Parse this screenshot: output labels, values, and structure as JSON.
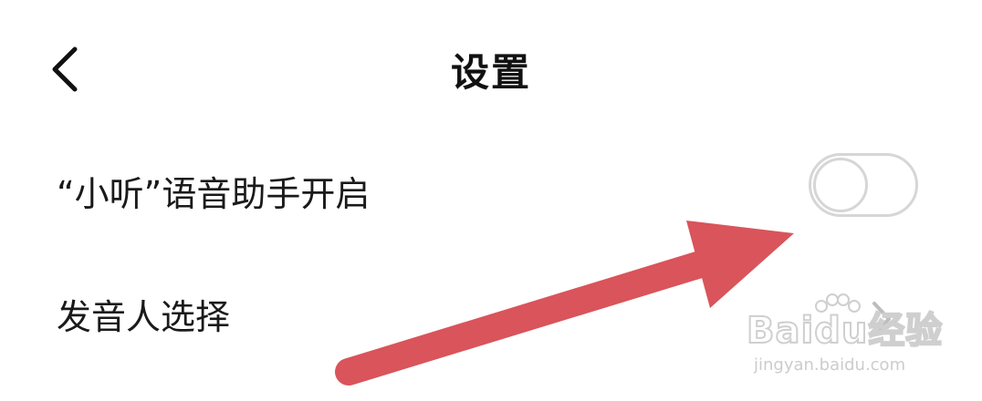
{
  "header": {
    "title": "设置",
    "back_icon": "chevron-left-icon"
  },
  "settings": {
    "voice_assistant": {
      "label": "“小听”语音助手开启",
      "enabled": false
    },
    "speaker_select": {
      "label": "发音人选择",
      "icon": "chevron-right-icon"
    }
  },
  "annotation": {
    "color": "#d9545b"
  },
  "watermark": {
    "brand": "Bai",
    "brand_suffix": "du",
    "product": "经验",
    "url": "jingyan.baidu.com"
  },
  "colors": {
    "toggle_border": "#d6d6d6",
    "text": "#1a1a1a",
    "background": "#ffffff"
  }
}
